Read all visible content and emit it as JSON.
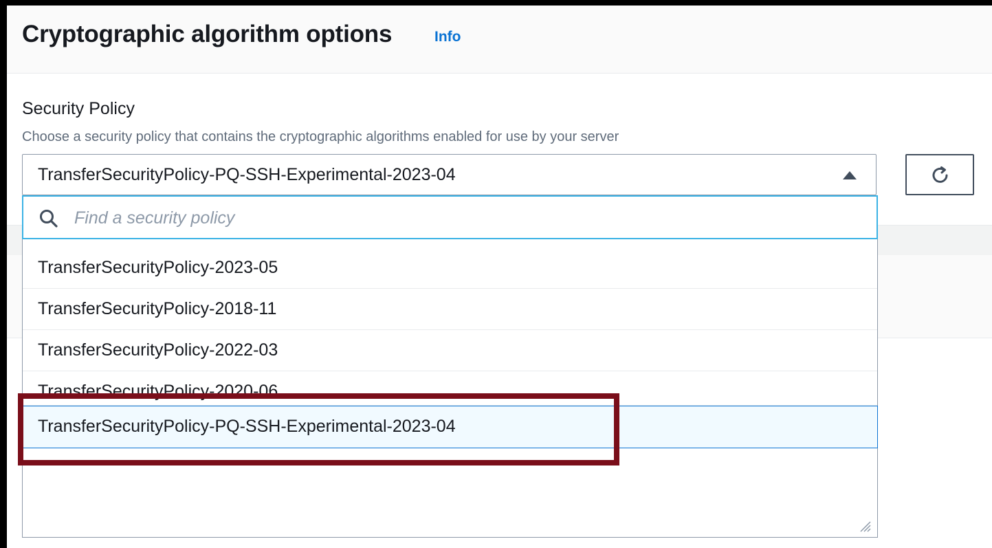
{
  "header": {
    "title": "Cryptographic algorithm options",
    "info_link": "Info"
  },
  "field": {
    "label": "Security Policy",
    "description": "Choose a security policy that contains the cryptographic algorithms enabled for use by your server",
    "selected_value": "TransferSecurityPolicy-PQ-SSH-Experimental-2023-04",
    "caret_icon": "caret-up-icon",
    "refresh_icon": "refresh-icon"
  },
  "search": {
    "placeholder": "Find a security policy",
    "icon": "search-icon"
  },
  "options": [
    "TransferSecurityPolicy-2023-05",
    "TransferSecurityPolicy-2018-11",
    "TransferSecurityPolicy-2022-03",
    "TransferSecurityPolicy-2020-06",
    "TransferSecurityPolicy-PQ-SSH-Experimental-2023-04"
  ],
  "highlighted_option_index": 4,
  "colors": {
    "accent": "#0972d3",
    "focus_ring": "#3ab2e5",
    "annotation_box": "#7a0e1a",
    "selected_bg": "#f1faff"
  }
}
